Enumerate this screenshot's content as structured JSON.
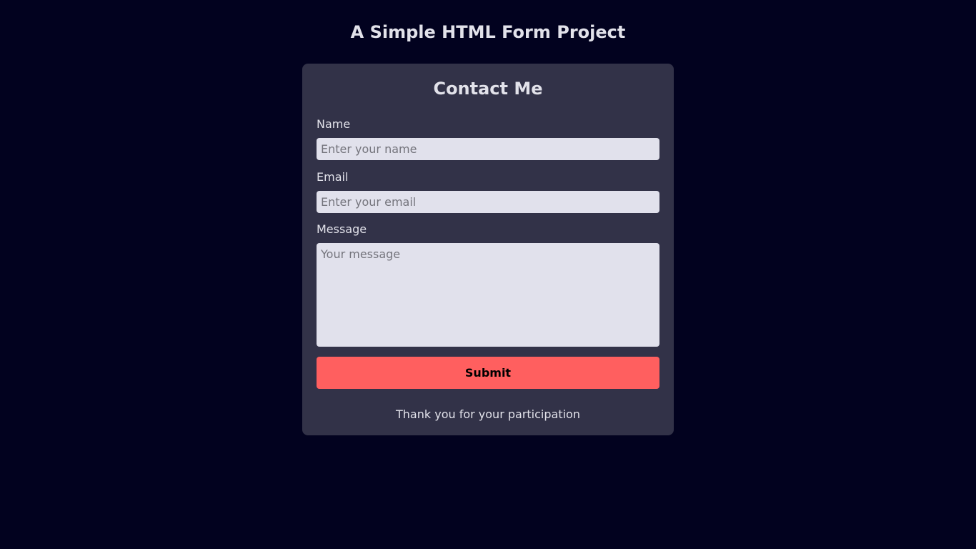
{
  "page": {
    "title": "A Simple HTML Form Project"
  },
  "form": {
    "title": "Contact Me",
    "name": {
      "label": "Name",
      "placeholder": "Enter your name",
      "value": ""
    },
    "email": {
      "label": "Email",
      "placeholder": "Enter your email",
      "value": ""
    },
    "message": {
      "label": "Message",
      "placeholder": "Your message",
      "value": ""
    },
    "submit_label": "Submit",
    "footer_text": "Thank you for your participation"
  },
  "colors": {
    "background": "#02021f",
    "card": "#323248",
    "input": "#e1e1ec",
    "submit": "#ff5f5f",
    "text": "#e2e2ea"
  }
}
